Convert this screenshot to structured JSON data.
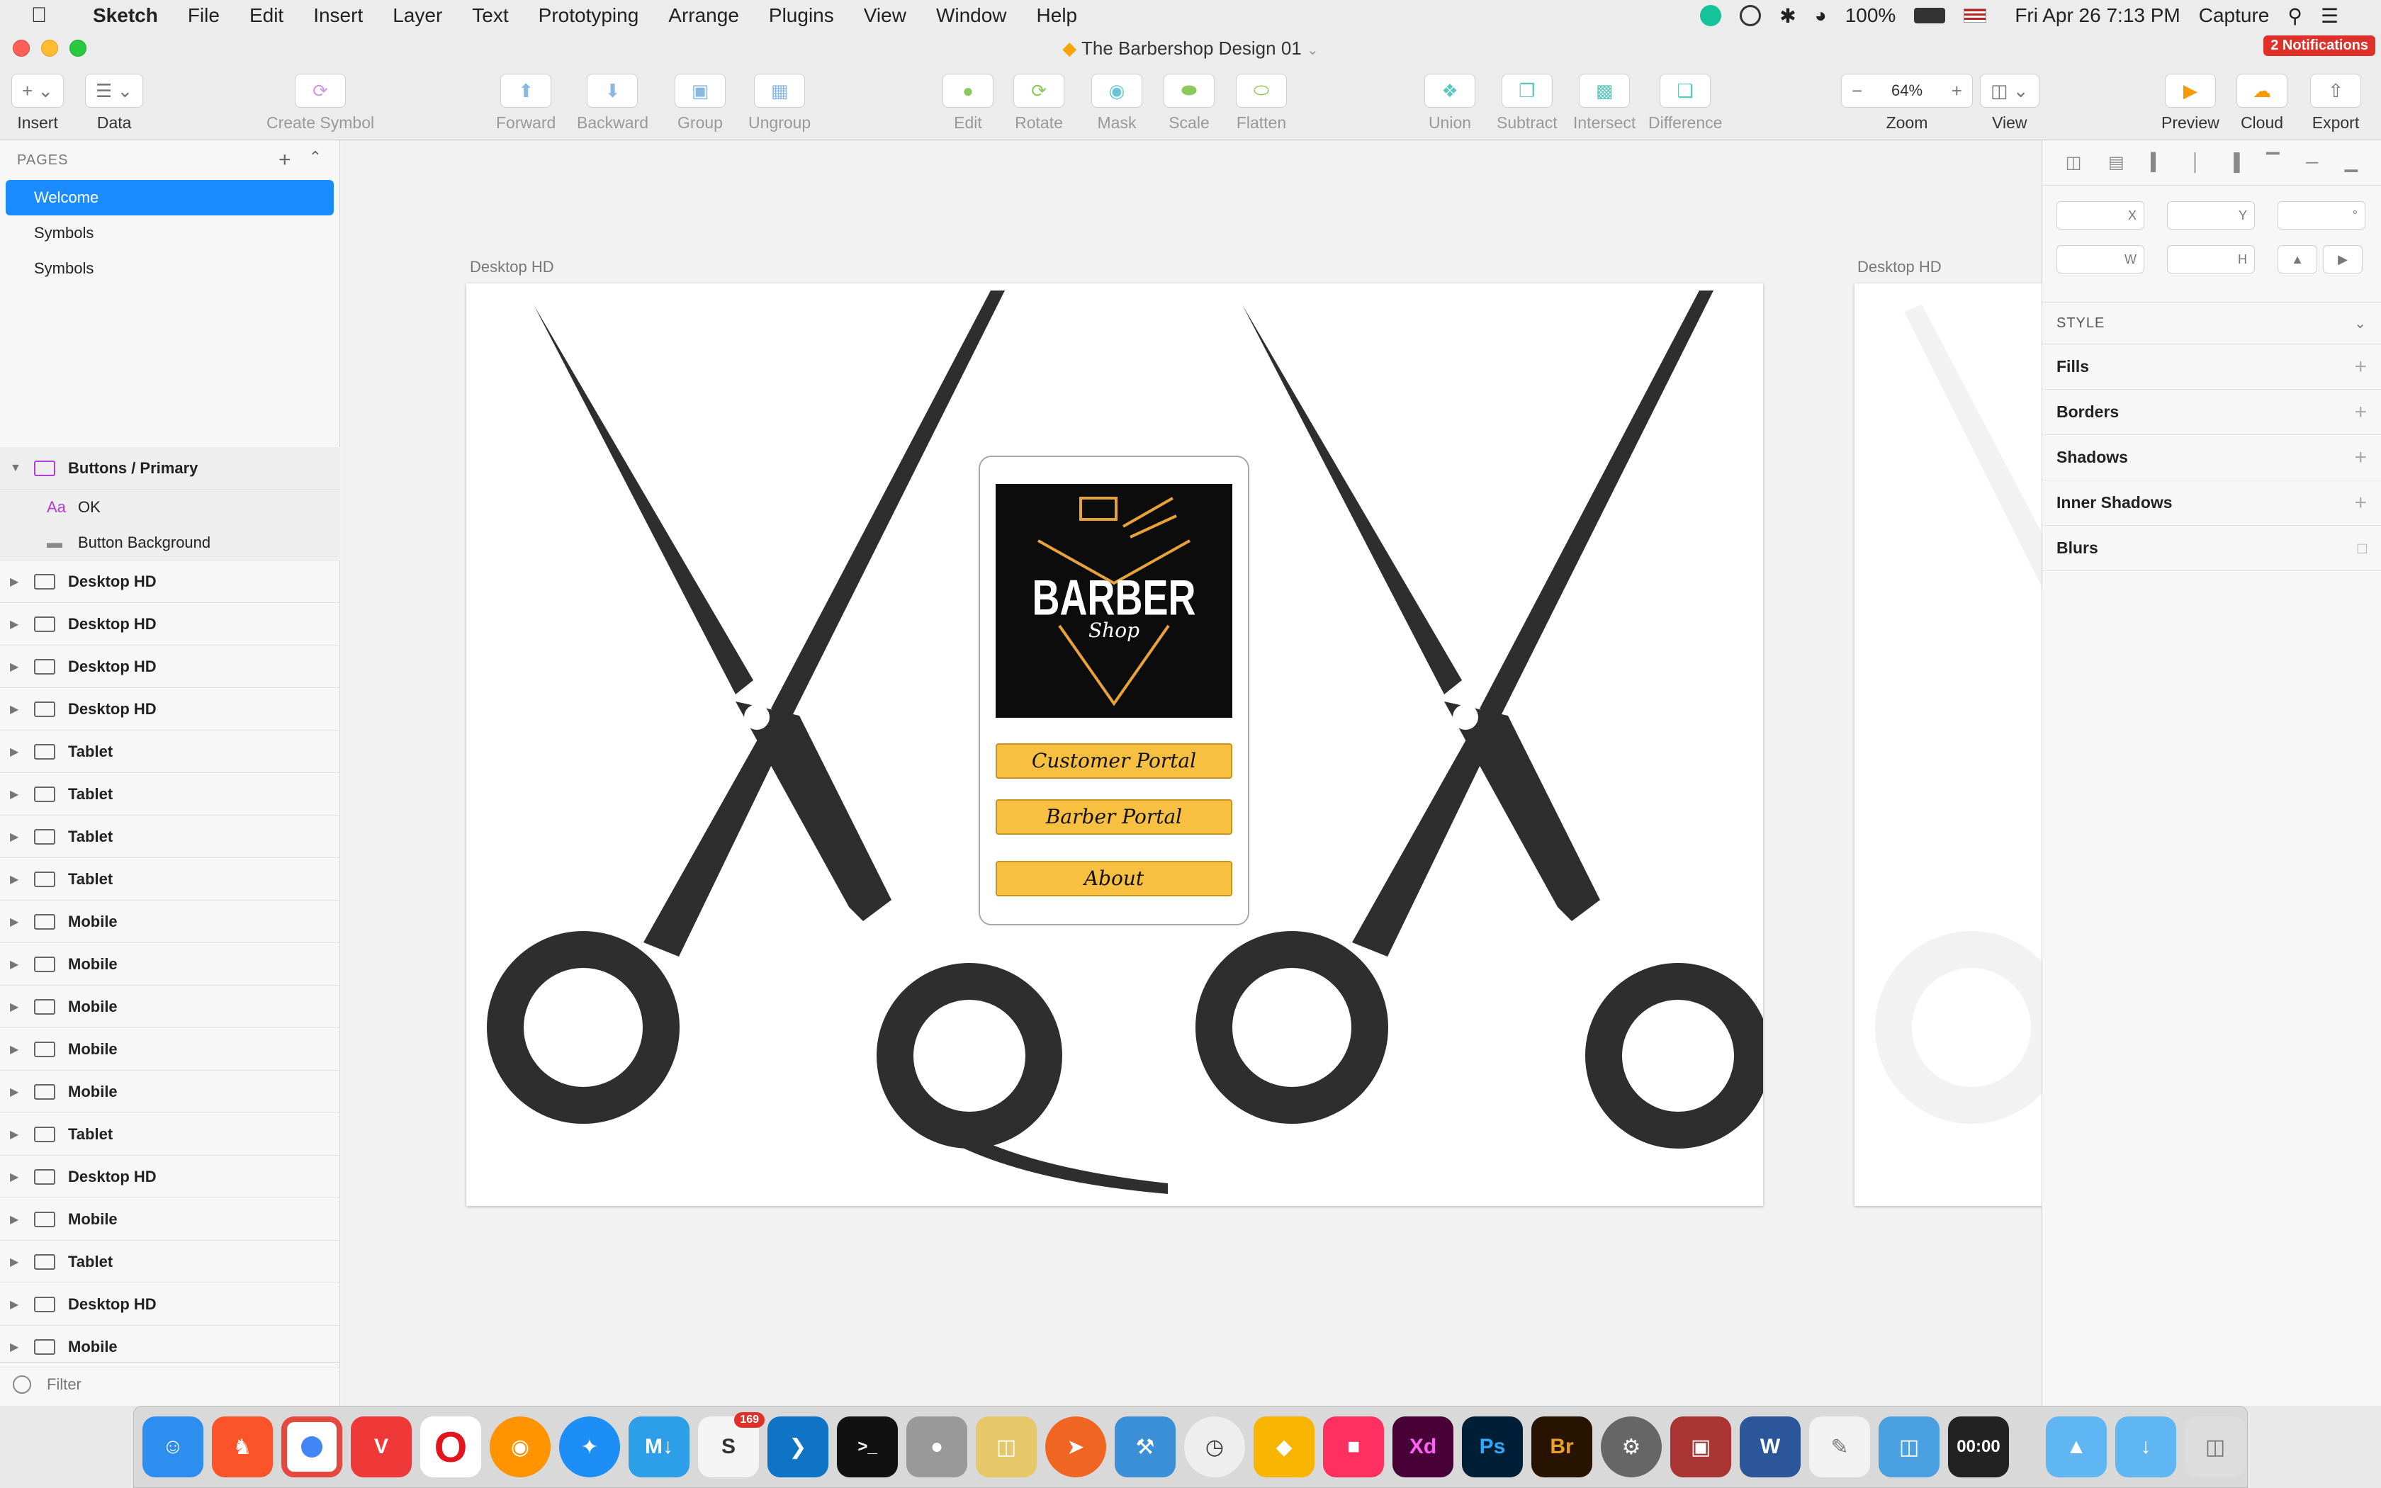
{
  "menubar": {
    "items": [
      "Sketch",
      "File",
      "Edit",
      "Insert",
      "Layer",
      "Text",
      "Prototyping",
      "Arrange",
      "Plugins",
      "View",
      "Window",
      "Help"
    ],
    "battery": "100%",
    "datetime": "Fri Apr 26  7:13 PM",
    "capture": "Capture",
    "notifications": "2 Notifications"
  },
  "window": {
    "title": "The Barbershop Design 01"
  },
  "toolbar": {
    "insert": "Insert",
    "data": "Data",
    "create_symbol": "Create Symbol",
    "forward": "Forward",
    "backward": "Backward",
    "group": "Group",
    "ungroup": "Ungroup",
    "edit": "Edit",
    "rotate": "Rotate",
    "mask": "Mask",
    "scale": "Scale",
    "flatten": "Flatten",
    "union": "Union",
    "subtract": "Subtract",
    "intersect": "Intersect",
    "difference": "Difference",
    "zoom_value": "64%",
    "zoom": "Zoom",
    "view": "View",
    "preview": "Preview",
    "cloud": "Cloud",
    "export": "Export"
  },
  "pages": {
    "header": "PAGES",
    "items": [
      "Welcome",
      "Symbols",
      "Symbols"
    ]
  },
  "layers": {
    "group_name": "Buttons / Primary",
    "children": [
      "OK",
      "Button Background"
    ],
    "artboards": [
      "Desktop HD",
      "Desktop HD",
      "Desktop HD",
      "Desktop HD",
      "Tablet",
      "Tablet",
      "Tablet",
      "Tablet",
      "Mobile",
      "Mobile",
      "Mobile",
      "Mobile",
      "Mobile",
      "Tablet",
      "Desktop HD",
      "Mobile",
      "Tablet",
      "Desktop HD",
      "Mobile"
    ]
  },
  "filter": "Filter",
  "canvas": {
    "artboard_label": "Desktop HD",
    "artboard2_label": "Desktop HD",
    "logo_title": "BARBER",
    "logo_subtitle": "Shop",
    "buttons": [
      "Customer Portal",
      "Barber Portal",
      "About"
    ]
  },
  "inspector": {
    "fields": {
      "x": "X",
      "y": "Y",
      "rotation": "°",
      "w": "W",
      "h": "H"
    },
    "style": "STYLE",
    "sections": [
      "Fills",
      "Borders",
      "Shadows",
      "Inner Shadows",
      "Blurs"
    ]
  },
  "dock": {
    "badge": "169",
    "clock_text": "00:00"
  }
}
